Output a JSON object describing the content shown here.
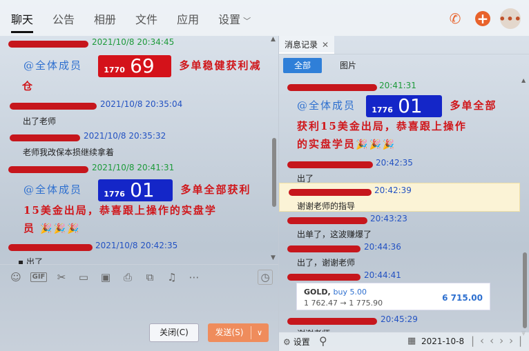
{
  "tabs": [
    {
      "label": "聊天",
      "active": true
    },
    {
      "label": "公告"
    },
    {
      "label": "相册"
    },
    {
      "label": "文件"
    },
    {
      "label": "应用"
    },
    {
      "label": "设置"
    }
  ],
  "top_icons": [
    "phone-icon",
    "plus-icon",
    "more-icon"
  ],
  "left_chat": {
    "messages": [
      {
        "time": "2021/10/8 20:34:45",
        "time_color": "#1d9a3a"
      },
      {
        "at": "@全体成员",
        "badge": {
          "small": "1770",
          "num": "69",
          "color": "#d4121a"
        },
        "text_line1": "多单稳健获利减",
        "text_line2": "仓"
      },
      {
        "time": "2021/10/8 20:35:04",
        "time_color": "#2352c2",
        "text": "出了老师"
      },
      {
        "time": "2021/10/8 20:35:32",
        "time_color": "#2352c2",
        "text": "老师我改保本损继续拿着"
      },
      {
        "time": "2021/10/8 20:41:31",
        "time_color": "#1d9a3a"
      },
      {
        "at": "@全体成员",
        "badge": {
          "small": "1776",
          "num": "01",
          "color": "#1426c8"
        },
        "text_line1": "多单全部获利",
        "text_line2": "15美金出局，恭喜跟上操作的实盘学",
        "text_line3": "员"
      },
      {
        "time": "2021/10/8 20:42:35",
        "time_color": "#2352c2",
        "text": "出了"
      }
    ]
  },
  "toolbar": {
    "icons": [
      "emoji-icon",
      "gif-icon",
      "scissors-icon",
      "folder-icon",
      "image-icon",
      "screenshot-icon",
      "clipboard-icon",
      "bell-icon",
      "more-icon",
      "history-clock-icon"
    ],
    "gif_label": "GIF"
  },
  "buttons": {
    "close_label": "关闭(C)",
    "send_label": "发送(S)"
  },
  "right_panel": {
    "tab_label": "消息记录",
    "filter_all": "全部",
    "filter_images": "图片",
    "messages": [
      {
        "time": "20:41:31",
        "time_color": "#1d9a3a"
      },
      {
        "at": "@全体成员",
        "badge": {
          "small": "1776",
          "num": "01"
        },
        "text_line1": "多单全部",
        "text_line2": "获利15美金出局，恭喜跟上操作",
        "text_line3": "的实盘学员"
      },
      {
        "time": "20:42:35",
        "time_color": "#2352c2",
        "text": "出了"
      },
      {
        "time": "20:42:39",
        "time_color": "#2352c2",
        "text": "谢谢老师的指导"
      },
      {
        "time": "20:43:23",
        "time_color": "#2352c2",
        "text": "出单了，这波赚爆了"
      },
      {
        "time": "20:44:36",
        "time_color": "#2352c2",
        "text": "出了，谢谢老师"
      },
      {
        "time": "20:44:41",
        "time_color": "#2352c2"
      },
      {
        "time": "20:45:29",
        "time_color": "#2352c2",
        "text": "谢谢老师"
      }
    ],
    "trade_card": {
      "symbol": "GOLD,",
      "side": "buy 5.00",
      "prices": "1 762.47 → 1 775.90",
      "profit": "6 715.00"
    },
    "bottom": {
      "settings_label": "设置",
      "date": "2021-10-8"
    }
  }
}
